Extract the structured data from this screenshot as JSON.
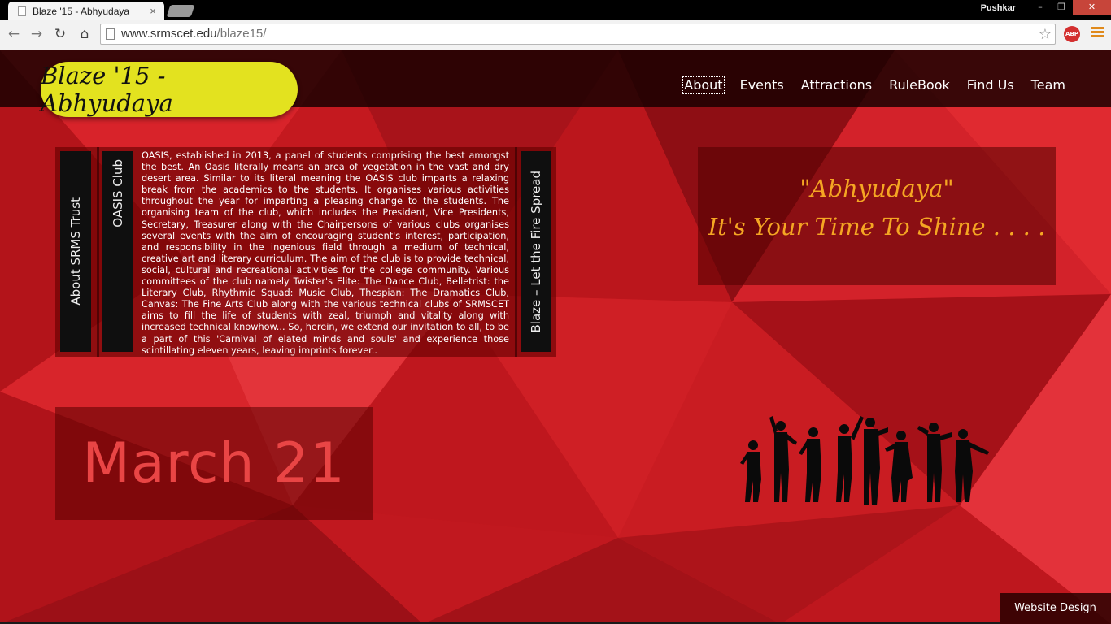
{
  "browser": {
    "tab_title": "Blaze '15 - Abhyudaya",
    "tab_close": "×",
    "profile_name": "Pushkar",
    "win_minimize": "–",
    "win_maximize": "❐",
    "win_close": "✕",
    "url_host": "www.srmscet.edu",
    "url_path": "/blaze15/",
    "abp_label": "ABP",
    "icons": [
      "back-arrow-icon",
      "forward-arrow-icon",
      "reload-icon",
      "home-icon",
      "star-icon",
      "abp-icon",
      "menu-icon"
    ]
  },
  "site": {
    "logo": "Blaze '15 - Abhyudaya",
    "nav": [
      "About",
      "Events",
      "Attractions",
      "RuleBook",
      "Find Us",
      "Team"
    ],
    "active_nav": "About",
    "side_tabs": [
      "About SRMS Trust",
      "OASIS Club",
      "Blaze – Let the Fire Spread"
    ],
    "about_text": "OASIS, established in 2013, a panel of students comprising the best amongst the best. An Oasis literally means an area of vegetation in the vast and dry desert area. Similar to its literal meaning the OASIS club imparts a relaxing break from the academics to the students. It organises various activities throughout the year for imparting a pleasing change to the students. The organising team of the club, which includes the President, Vice Presidents, Secretary, Treasurer along with the Chairpersons of various clubs organises several events with the aim of encouraging student's interest, participation, and responsibility in the ingenious field through a medium of technical, creative art and literary curriculum. The aim of the club is to provide technical, social, cultural and recreational activities for the college community. Various committees of the club namely Twister's Elite: The Dance Club, Belletrist: the Literary Club, Rhythmic Squad: Music Club, Thespian: The Dramatics Club, Canvas: The Fine Arts Club along with the various technical clubs of SRMSCET aims to fill the life of students with zeal, triumph and vitality along with increased technical knowhow... So, herein, we extend our invitation to all, to be a part of this 'Carnival of elated minds and souls' and experience those scintillating eleven years, leaving imprints forever..",
    "tagline_line1": "\"Abhyudaya\"",
    "tagline_line2": "It's Your Time To Shine . . . .",
    "date": "March 21",
    "design_credit": "Website Design",
    "colors": {
      "background": "#c51a1e",
      "logo_bg": "#e3e21f",
      "tagline": "#f5a623",
      "date_text": "#e94545"
    }
  }
}
